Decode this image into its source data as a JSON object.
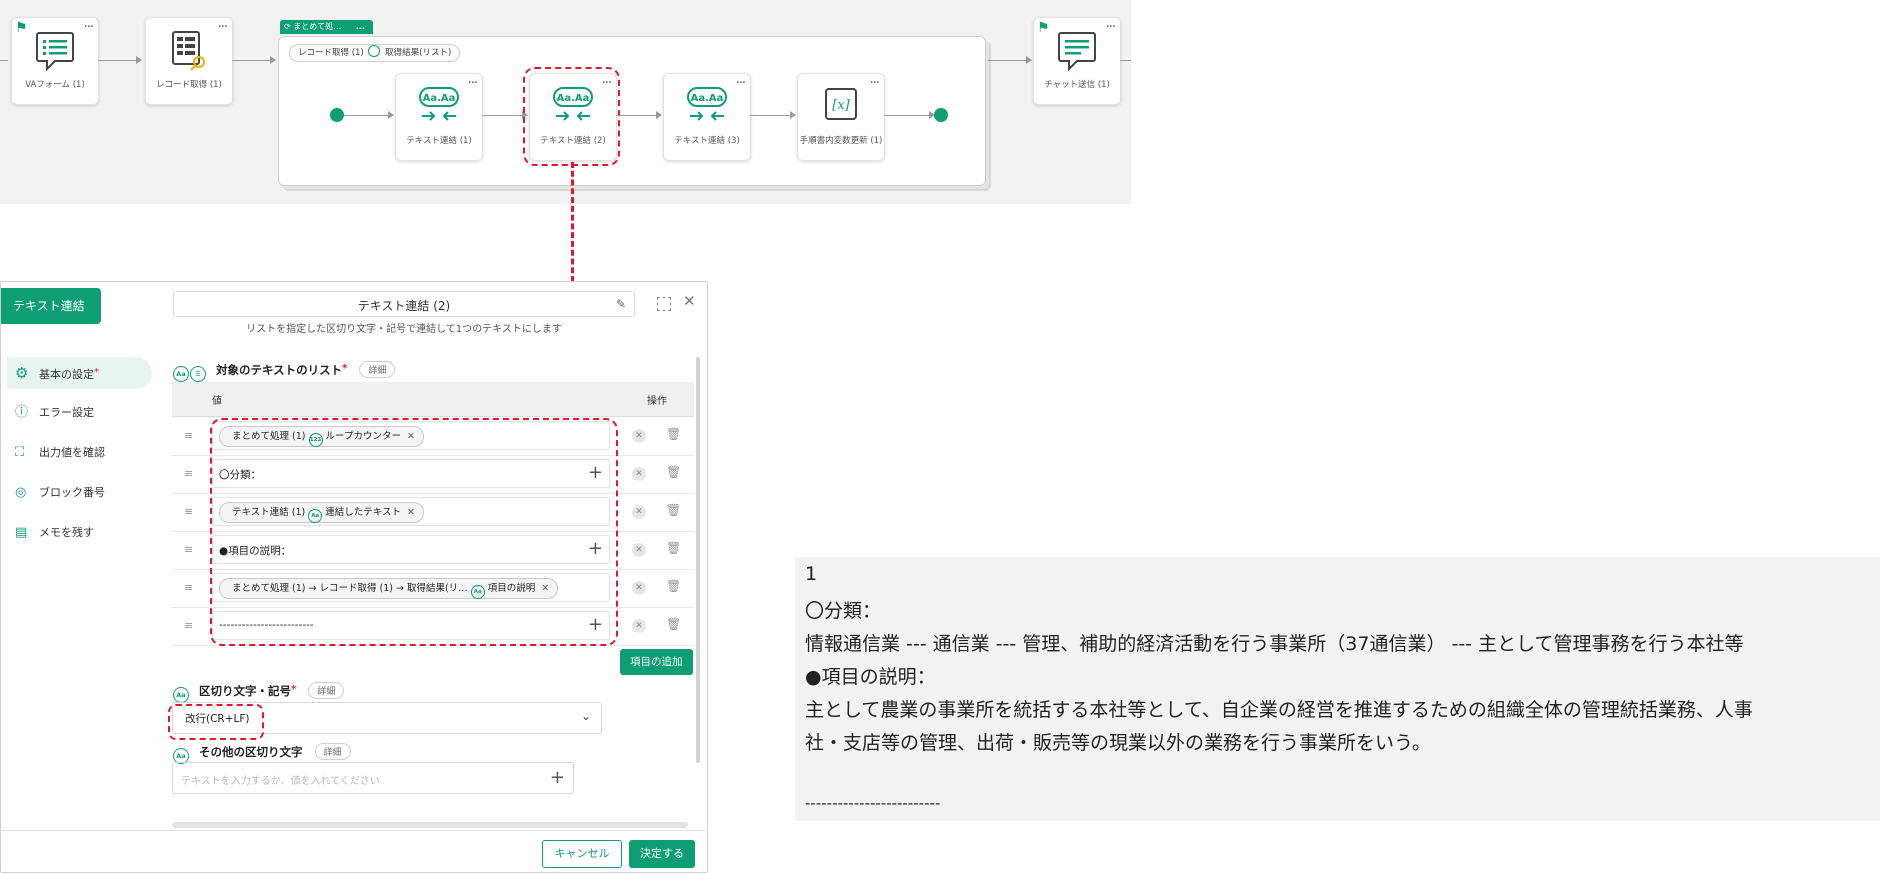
{
  "flow": {
    "nodes": {
      "va_form": "VAフォーム (1)",
      "record_get": "レコード取得 (1)",
      "text_concat_1": "テキスト連結 (1)",
      "text_concat_2": "テキスト連結 (2)",
      "text_concat_3": "テキスト連結 (3)",
      "var_update": "手順書内変数更新 (1)",
      "chat_send": "チャット送信 (1)"
    },
    "group_tag": "まとめて処…",
    "group_tag_menu": "...",
    "group_chip_left": "レコード取得 (1)",
    "group_chip_right": "取得結果(リスト)",
    "node_menu": "...",
    "icon_text": "Aa.Aa"
  },
  "dialog": {
    "tab_label": "テキスト連結",
    "title": "テキスト連結 (2)",
    "subtitle": "リストを指定した区切り文字・記号で連結して1つのテキストにします",
    "close_glyph": "✕",
    "nav": [
      {
        "label": "基本の設定",
        "required": "*"
      },
      {
        "label": "エラー設定"
      },
      {
        "label": "出力値を確認"
      },
      {
        "label": "ブロック番号"
      },
      {
        "label": "メモを残す"
      }
    ],
    "list_section": {
      "title": "対象のテキストのリスト",
      "required": "*",
      "detail": "詳細",
      "col_value": "値",
      "col_action": "操作",
      "rows": [
        {
          "chip_a": "まとめて処理 (1)",
          "chip_b": "ループカウンター"
        },
        {
          "text": "〇分類："
        },
        {
          "chip_a": "テキスト連結 (1)",
          "chip_b": "連結したテキスト"
        },
        {
          "text": "●項目の説明："
        },
        {
          "chip_a": "まとめて処理 (1) → レコード取得 (1) → 取得結果(リ…",
          "chip_b": "項目の説明"
        },
        {
          "text": "-------------------------"
        }
      ],
      "add_button": "項目の追加"
    },
    "separator_section": {
      "title": "区切り文字・記号",
      "required": "*",
      "detail": "詳細",
      "value": "改行(CR+LF)"
    },
    "other_separator": {
      "title": "その他の区切り文字",
      "detail": "詳細",
      "placeholder": "テキストを入力するか、値を入れてください"
    },
    "cancel": "キャンセル",
    "ok": "決定する"
  },
  "output": {
    "lines": [
      "1",
      "〇分類：",
      "情報通信業 --- 通信業 --- 管理、補助的経済活動を行う事業所（37通信業） --- 主として管理事務を行う本社等",
      "●項目の説明：",
      "主として農業の事業所を統括する本社等として、自企業の経営を推進するための組織全体の管理統括業務、人事",
      "社・支店等の管理、出荷・販売等の現業以外の業務を行う事業所をいう。",
      "",
      "-------------------------"
    ]
  },
  "colors": {
    "accent": "#0e9e74",
    "highlight": "#e0182d",
    "canvas": "#f2f2f2"
  }
}
